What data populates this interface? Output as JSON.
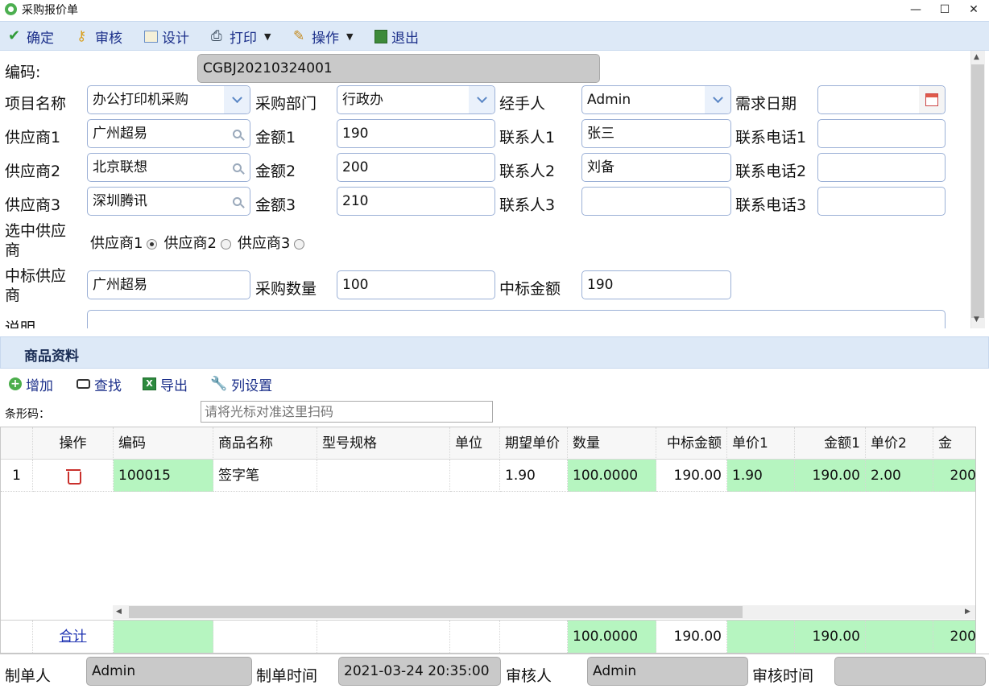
{
  "window": {
    "title": "采购报价单",
    "minimize": "—",
    "maximize": "☐",
    "close": "✕"
  },
  "toolbar": {
    "confirm": "确定",
    "audit": "审核",
    "design": "设计",
    "print": "打印",
    "operate": "操作",
    "exit": "退出"
  },
  "form": {
    "code_label": "编码:",
    "code_value": "CGBJ20210324001",
    "project_label": "项目名称",
    "project_value": "办公打印机采购",
    "dept_label": "采购部门",
    "dept_value": "行政办",
    "handler_label": "经手人",
    "handler_value": "Admin",
    "need_date_label": "需求日期",
    "need_date_value": "",
    "suppliers": [
      {
        "label": "供应商1",
        "value": "广州超易",
        "amount_label": "金额1",
        "amount": "190",
        "contact_label": "联系人1",
        "contact": "张三",
        "phone_label": "联系电话1",
        "phone": ""
      },
      {
        "label": "供应商2",
        "value": "北京联想",
        "amount_label": "金额2",
        "amount": "200",
        "contact_label": "联系人2",
        "contact": "刘备",
        "phone_label": "联系电话2",
        "phone": ""
      },
      {
        "label": "供应商3",
        "value": "深圳腾讯",
        "amount_label": "金额3",
        "amount": "210",
        "contact_label": "联系人3",
        "contact": "",
        "phone_label": "联系电话3",
        "phone": ""
      }
    ],
    "selected_label_line1": "选中供应",
    "selected_label_line2": "商",
    "radio_options": [
      "供应商1",
      "供应商2",
      "供应商3"
    ],
    "radio_selected": 0,
    "winner_label_line1": "中标供应",
    "winner_label_line2": "商",
    "winner_value": "广州超易",
    "qty_label": "采购数量",
    "qty_value": "100",
    "win_amount_label": "中标金额",
    "win_amount_value": "190",
    "desc_label": "说明",
    "desc_value": ""
  },
  "goods": {
    "section_title": "商品资料",
    "add": "增加",
    "find": "查找",
    "export": "导出",
    "col_settings": "列设置",
    "barcode_label": "条形码：",
    "barcode_placeholder": "请将光标对准这里扫码",
    "columns": [
      "操作",
      "编码",
      "商品名称",
      "型号规格",
      "单位",
      "期望单价",
      "数量",
      "中标金额",
      "单价1",
      "金额1",
      "单价2",
      "金"
    ],
    "rows": [
      {
        "index": "1",
        "code": "100015",
        "name": "签字笔",
        "spec": "",
        "unit": "",
        "expect_price": "1.90",
        "qty": "100.0000",
        "win_amount": "190.00",
        "price1": "1.90",
        "amount1": "190.00",
        "price2": "2.00",
        "amount2": "200"
      }
    ],
    "total": {
      "label": "合计",
      "qty": "100.0000",
      "win_amount": "190.00",
      "amount1": "190.00",
      "amount2": "200"
    }
  },
  "footer": {
    "maker_label": "制单人",
    "maker_value": "Admin",
    "make_time_label": "制单时间",
    "make_time_value": "2021-03-24 20:35:00",
    "auditor_label": "审核人",
    "auditor_value": "Admin",
    "audit_time_label": "审核时间",
    "audit_time_value": ""
  },
  "colors": {
    "accent": "#1b2f8a",
    "toolbar_bg": "#dde9f7",
    "grid_highlight": "#b6f5c0"
  }
}
